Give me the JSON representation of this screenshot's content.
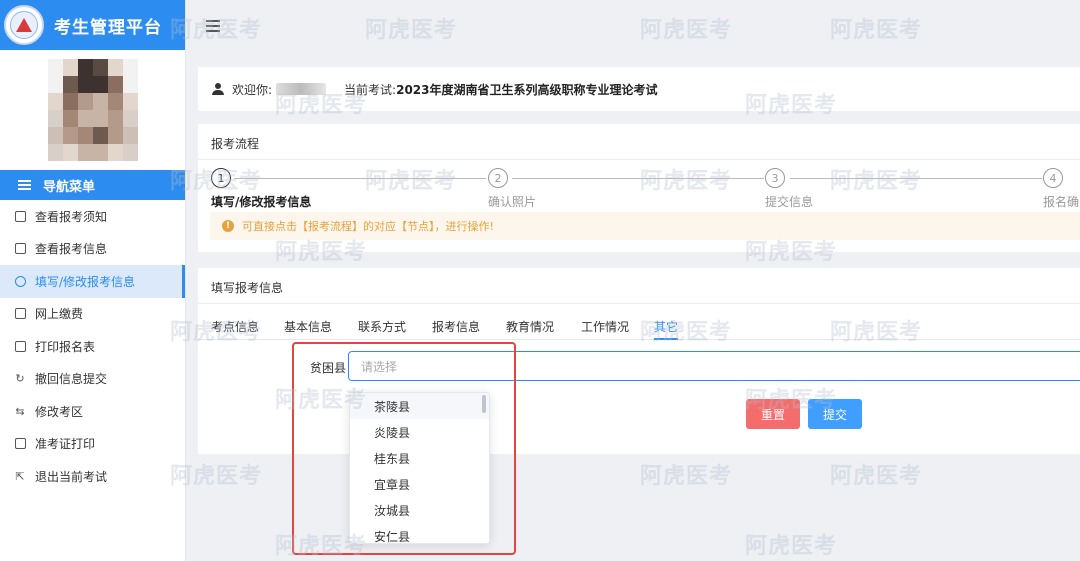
{
  "brand": {
    "title": "考生管理平台"
  },
  "sidebar": {
    "nav_title": "导航菜单",
    "items": [
      {
        "label": "查看报考须知",
        "icon": "message-icon"
      },
      {
        "label": "查看报考信息",
        "icon": "document-icon"
      },
      {
        "label": "填写/修改报考信息",
        "icon": "check-circle-icon",
        "active": true
      },
      {
        "label": "网上缴费",
        "icon": "payment-icon"
      },
      {
        "label": "打印报名表",
        "icon": "print-icon"
      },
      {
        "label": "撤回信息提交",
        "icon": "refresh-icon"
      },
      {
        "label": "修改考区",
        "icon": "swap-icon"
      },
      {
        "label": "准考证打印",
        "icon": "card-icon"
      },
      {
        "label": "退出当前考试",
        "icon": "exit-icon"
      }
    ]
  },
  "welcome": {
    "greeting": "欢迎你:",
    "current_exam_label": "当前考试:",
    "current_exam": "2023年度湖南省卫生系列高级职称专业理论考试"
  },
  "flow": {
    "title": "报考流程",
    "steps": [
      {
        "num": "1",
        "label": "填写/修改报考信息"
      },
      {
        "num": "2",
        "label": "确认照片"
      },
      {
        "num": "3",
        "label": "提交信息"
      },
      {
        "num": "4",
        "label": "报名确"
      }
    ],
    "tip": "可直接点击【报考流程】的对应【节点】，进行操作!"
  },
  "form": {
    "title": "填写报考信息",
    "tabs": [
      "考点信息",
      "基本信息",
      "联系方式",
      "报考信息",
      "教育情况",
      "工作情况",
      "其它"
    ],
    "active_tab": "其它",
    "field_label": "贫困县",
    "placeholder": "请选择",
    "reset_label": "重置",
    "submit_label": "提交",
    "options": [
      "茶陵县",
      "炎陵县",
      "桂东县",
      "宜章县",
      "汝城县",
      "安仁县"
    ]
  },
  "watermark": "阿虎医考",
  "colors": {
    "primary": "#2d8cf0",
    "danger": "#f56c6c",
    "warning": "#e6a23c",
    "highlight": "#e2463f"
  }
}
